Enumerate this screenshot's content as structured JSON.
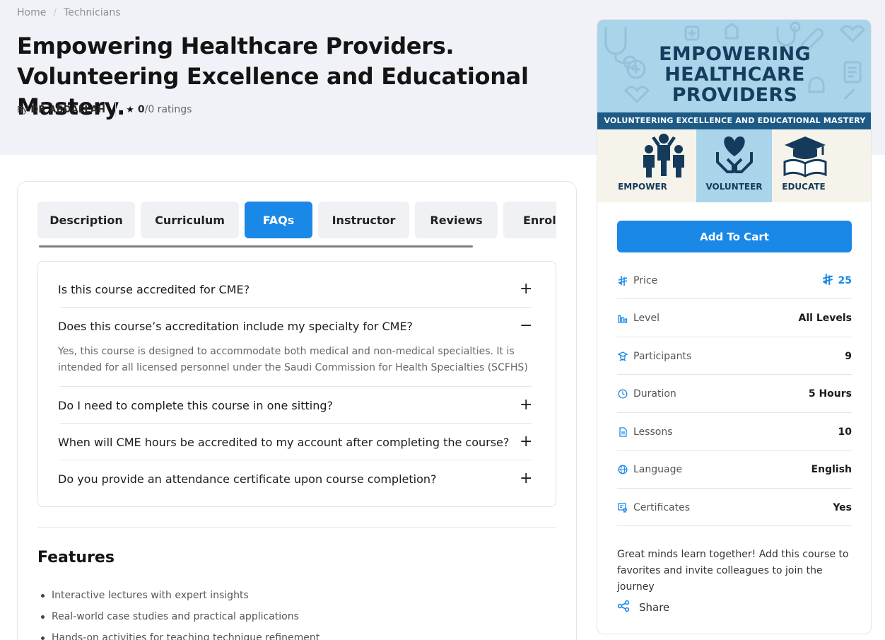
{
  "breadcrumb": {
    "home": "Home",
    "separator": "/",
    "current": "Technicians"
  },
  "course": {
    "title": "Empowering Healthcare Providers. Volunteering Excellence and Educational Mastery.",
    "by_label": "By",
    "author": "DR ABDALLAH",
    "rating_value": "0",
    "rating_text": "/0 ratings"
  },
  "tabs": [
    {
      "label": "Description",
      "active": false
    },
    {
      "label": "Curriculum",
      "active": false
    },
    {
      "label": "FAQs",
      "active": true
    },
    {
      "label": "Instructor",
      "active": false
    },
    {
      "label": "Reviews",
      "active": false
    },
    {
      "label": "Enrolle",
      "active": false
    }
  ],
  "faqs": [
    {
      "question": "Is this course accredited for CME?",
      "expanded": false,
      "toggle": "+"
    },
    {
      "question": "Does this course’s accreditation include my specialty for CME?",
      "expanded": true,
      "toggle": "−",
      "answer": "Yes, this course is designed to accommodate both medical and non-medical specialties. It is intended for all licensed personnel under the Saudi Commission for Health Specialties (SCFHS)"
    },
    {
      "question": "Do I need to complete this course in one sitting?",
      "expanded": false,
      "toggle": "+"
    },
    {
      "question": "When will CME hours be accredited to my account after completing the course?",
      "expanded": false,
      "toggle": "+"
    },
    {
      "question": "Do you provide an attendance certificate upon course completion?",
      "expanded": false,
      "toggle": "+"
    }
  ],
  "features": {
    "title": "Features",
    "items": [
      "Interactive lectures with expert insights",
      "Real-world case studies and practical applications",
      "Hands-on activities for teaching technique refinement"
    ]
  },
  "thumbnail": {
    "title_lines": [
      "EMPOWERING",
      "HEALTHCARE",
      "PROVIDERS"
    ],
    "band": "VOLUNTEERING EXCELLENCE AND EDUCATIONAL MASTERY",
    "pillars": [
      "EMPOWER",
      "VOLUNTEER",
      "EDUCATE"
    ]
  },
  "sidebar": {
    "cart_button": "Add To Cart",
    "meta": [
      {
        "icon": "currency-icon",
        "label": "Price",
        "value": "25"
      },
      {
        "icon": "bar-chart-icon",
        "label": "Level",
        "value": "All Levels"
      },
      {
        "icon": "participants-icon",
        "label": "Participants",
        "value": "9"
      },
      {
        "icon": "clock-icon",
        "label": "Duration",
        "value": "5 Hours"
      },
      {
        "icon": "document-icon",
        "label": "Lessons",
        "value": "10"
      },
      {
        "icon": "globe-icon",
        "label": "Language",
        "value": "English"
      },
      {
        "icon": "certificate-icon",
        "label": "Certificates",
        "value": "Yes"
      }
    ],
    "note": "Great minds learn together! Add this course to favorites and invite colleagues to join the journey",
    "share_label": "Share"
  },
  "colors": {
    "accent": "#1a88e6",
    "hero_bg": "#f1f2f7",
    "thumb_sky": "#a9d4ea",
    "thumb_navy": "#1d5a86"
  }
}
